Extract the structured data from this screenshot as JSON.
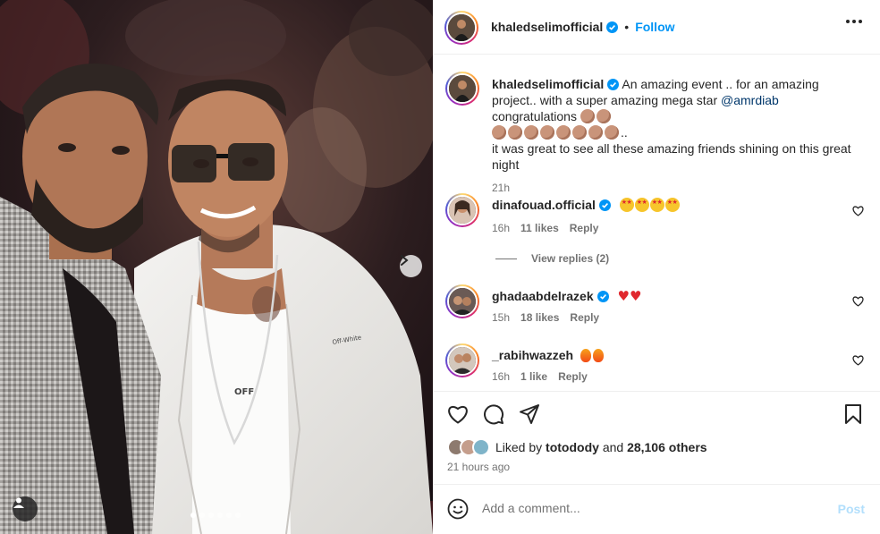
{
  "post": {
    "username": "khaledselimofficial",
    "follow_label": "Follow",
    "separator": "•"
  },
  "caption": {
    "username": "khaledselimofficial",
    "text_part1": "An amazing event .. for an amazing project.. with a super amazing mega star",
    "mention": "@amrdiab",
    "text_part2": "congratulations",
    "text_part3": "..",
    "text_part4": "it was great to see all these amazing friends shining on this great night",
    "time": "21h"
  },
  "comments": [
    {
      "username": "dinafouad.official",
      "time": "16h",
      "likes": "11 likes",
      "reply": "Reply"
    },
    {
      "username": "ghadaabdelrazek",
      "time": "15h",
      "likes": "18 likes",
      "reply": "Reply"
    },
    {
      "username": "_rabihwazzeh",
      "time": "16h",
      "likes": "1 like",
      "reply": "Reply"
    }
  ],
  "view_replies": "View replies (2)",
  "likes": {
    "prefix": "Liked by",
    "user": "totodody",
    "middle": "and",
    "count": "28,106 others"
  },
  "posted_ago": "21 hours ago",
  "comment_box": {
    "placeholder": "Add a comment...",
    "post_label": "Post"
  },
  "carousel": {
    "slides": 6,
    "active_index": 0
  },
  "colors": {
    "accent": "#0095f6",
    "mention": "#00376b",
    "secondary_text": "#737373",
    "post_disabled": "#b2dffc"
  }
}
